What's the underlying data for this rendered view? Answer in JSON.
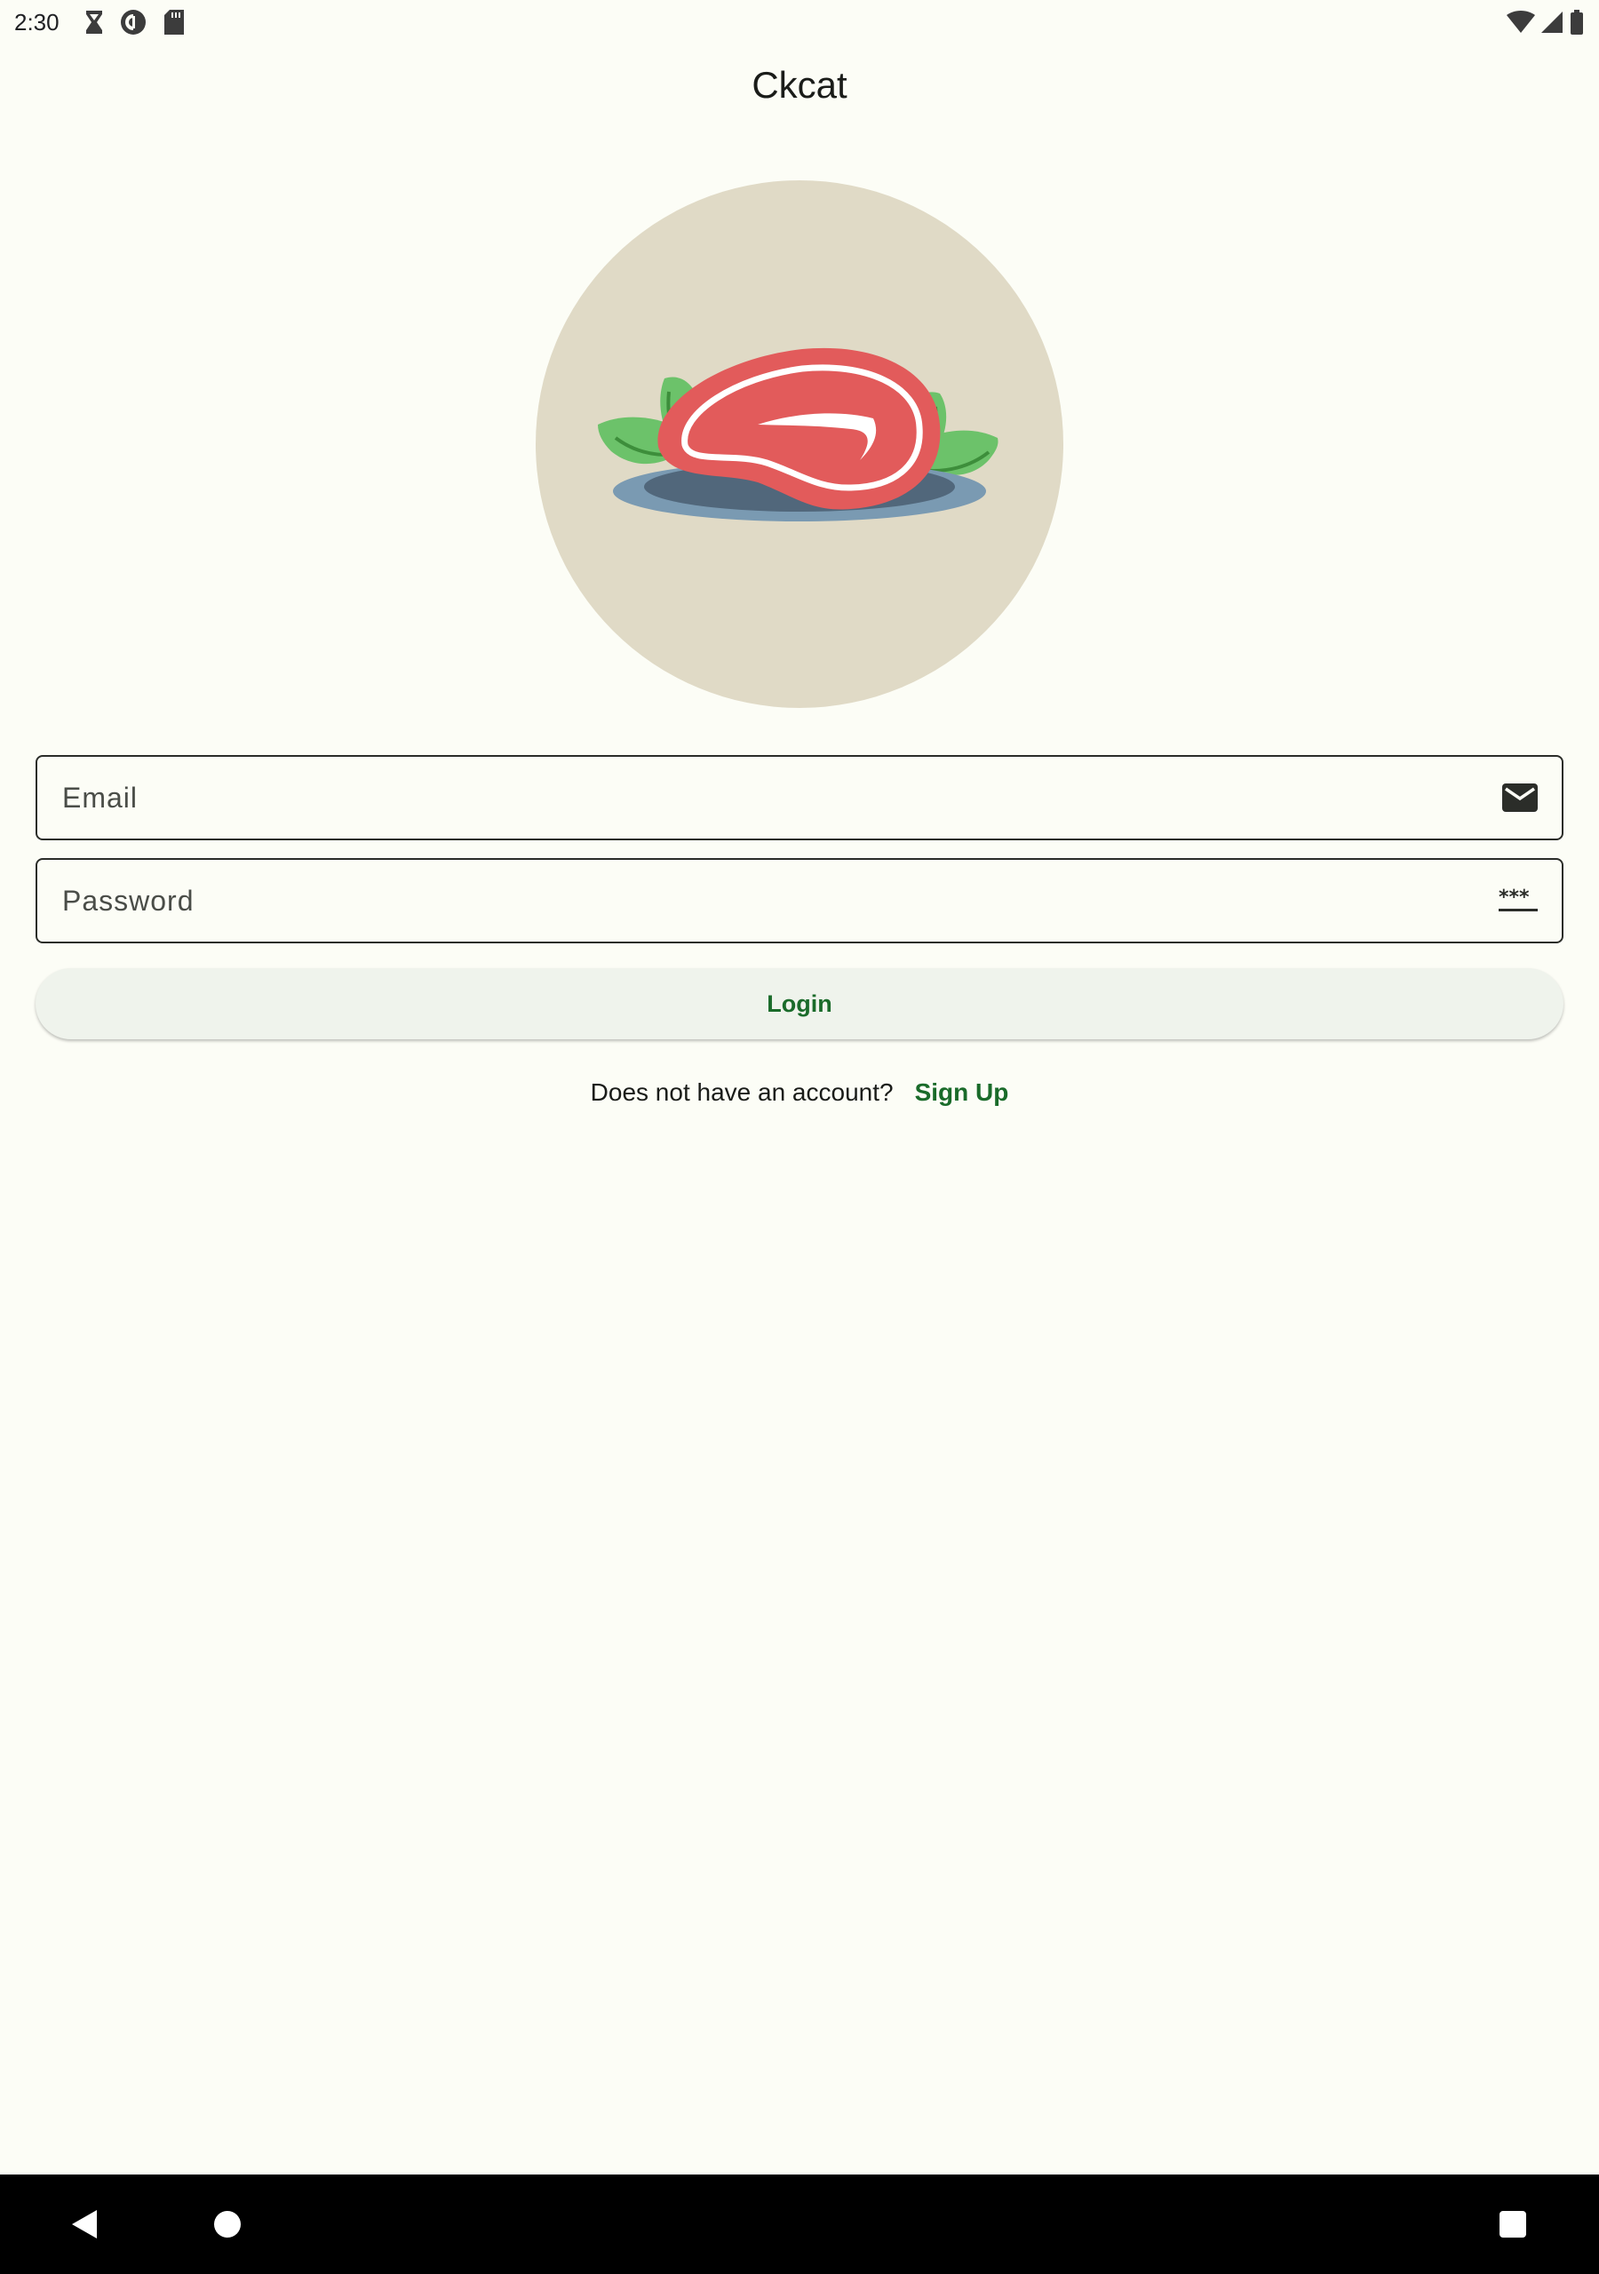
{
  "status_bar": {
    "time": "2:30",
    "left_icons": [
      "hourglass-icon",
      "pocket-casts-icon",
      "sd-card-icon"
    ],
    "right_icons": [
      "wifi-icon",
      "cell-signal-icon",
      "battery-icon"
    ]
  },
  "app": {
    "title": "Ckcat"
  },
  "hero": {
    "image": "steak-on-plate-illustration",
    "background_color": "#e0dac6"
  },
  "form": {
    "email": {
      "placeholder": "Email",
      "value": "",
      "icon": "email-icon"
    },
    "password": {
      "placeholder": "Password",
      "value": "",
      "icon": "password-icon"
    },
    "login_label": "Login"
  },
  "signup": {
    "prompt": "Does not have an account?",
    "link_label": "Sign Up"
  },
  "nav": {
    "buttons": [
      "back-icon",
      "home-icon",
      "recents-icon"
    ]
  },
  "colors": {
    "background": "#fcfdf6",
    "accent": "#1a6b2a",
    "button_bg": "#eff3ec"
  }
}
